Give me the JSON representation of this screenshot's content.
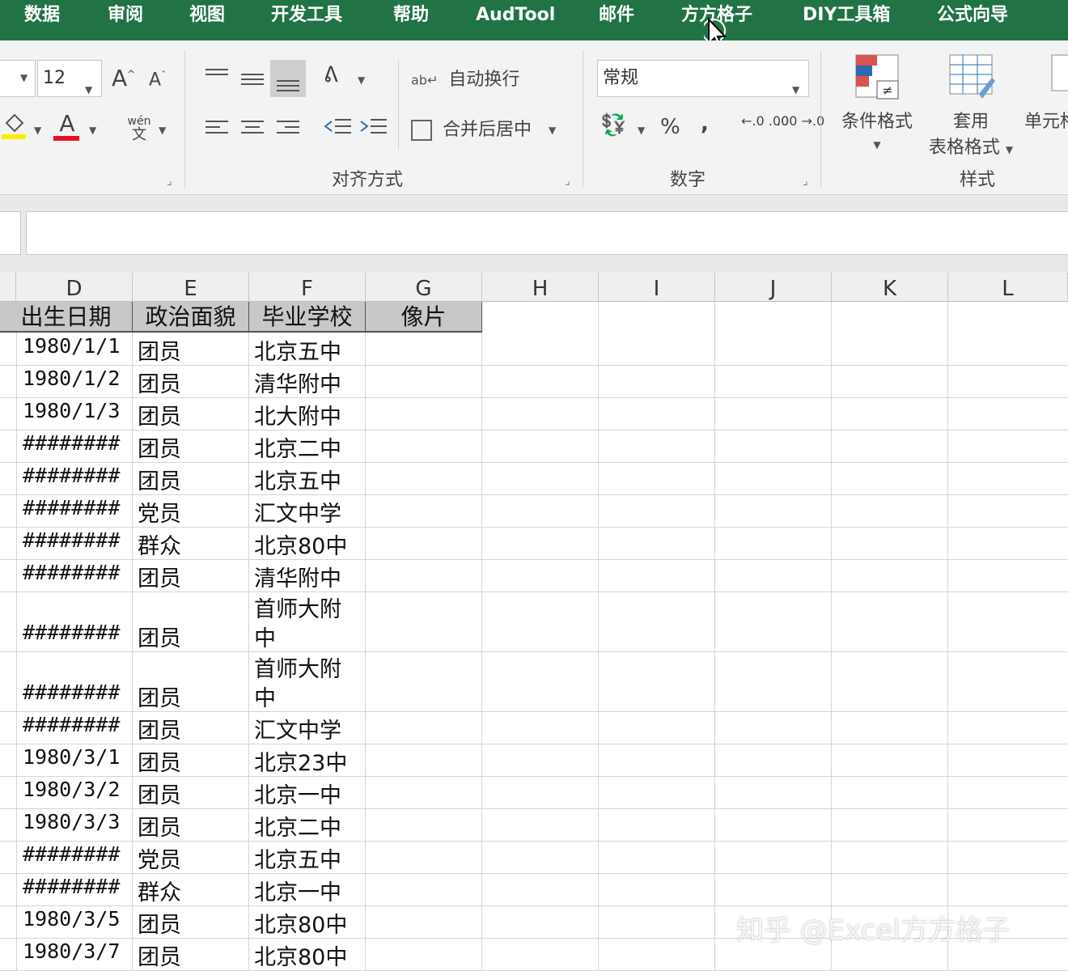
{
  "menu": {
    "tabs": [
      "数据",
      "审阅",
      "视图",
      "开发工具",
      "帮助",
      "AudTool",
      "邮件",
      "方方格子",
      "DIY工具箱",
      "公式向导"
    ]
  },
  "ribbon": {
    "font_size": "12",
    "grow_font": "A",
    "shrink_font": "A",
    "phonetic": "wén",
    "phonetic_char": "文",
    "wrap_text": "自动换行",
    "merge_center": "合并后居中",
    "alignment_group": "对齐方式",
    "number_format": "常规",
    "percent": "%",
    "comma": ",",
    "number_group": "数字",
    "conditional_format": "条件格式",
    "table_format_1": "套用",
    "table_format_2": "表格格式",
    "cell_styles": "单元格",
    "styles_group": "样式",
    "font_color_letter": "A",
    "increase_decimal": "←.0 .00",
    "decrease_decimal": ".00 →.0"
  },
  "colors": {
    "title_bar": "#217346",
    "header_fill": "#c8c8c8",
    "font_color": "#e81123",
    "fill_color": "#ffeb00"
  },
  "sheet": {
    "column_letters": [
      "D",
      "E",
      "F",
      "G",
      "H",
      "I",
      "J",
      "K",
      "L"
    ],
    "headers": [
      "出生日期",
      "政治面貌",
      "毕业学校",
      "像片"
    ],
    "rows": [
      {
        "date": "1980/1/1",
        "status": "团员",
        "school": "北京五中"
      },
      {
        "date": "1980/1/2",
        "status": "团员",
        "school": "清华附中"
      },
      {
        "date": "1980/1/3",
        "status": "团员",
        "school": "北大附中"
      },
      {
        "date": "########",
        "status": "团员",
        "school": "北京二中"
      },
      {
        "date": "########",
        "status": "团员",
        "school": "北京五中"
      },
      {
        "date": "########",
        "status": "党员",
        "school": "汇文中学"
      },
      {
        "date": "########",
        "status": "群众",
        "school": "北京80中"
      },
      {
        "date": "########",
        "status": "团员",
        "school": "清华附中"
      },
      {
        "date": "########",
        "status": "团员",
        "school": "首师大附",
        "school2": "中"
      },
      {
        "date": "########",
        "status": "团员",
        "school": "首师大附",
        "school2": "中"
      },
      {
        "date": "########",
        "status": "团员",
        "school": "汇文中学"
      },
      {
        "date": "1980/3/1",
        "status": "团员",
        "school": "北京23中"
      },
      {
        "date": "1980/3/2",
        "status": "团员",
        "school": "北京一中"
      },
      {
        "date": "1980/3/3",
        "status": "团员",
        "school": "北京二中"
      },
      {
        "date": "########",
        "status": "党员",
        "school": "北京五中"
      },
      {
        "date": "########",
        "status": "群众",
        "school": "北京一中"
      },
      {
        "date": "1980/3/5",
        "status": "团员",
        "school": "北京80中"
      },
      {
        "date": "1980/3/7",
        "status": "团员",
        "school": "北京80中"
      }
    ]
  },
  "watermark": "知乎 @Excel方方格子"
}
